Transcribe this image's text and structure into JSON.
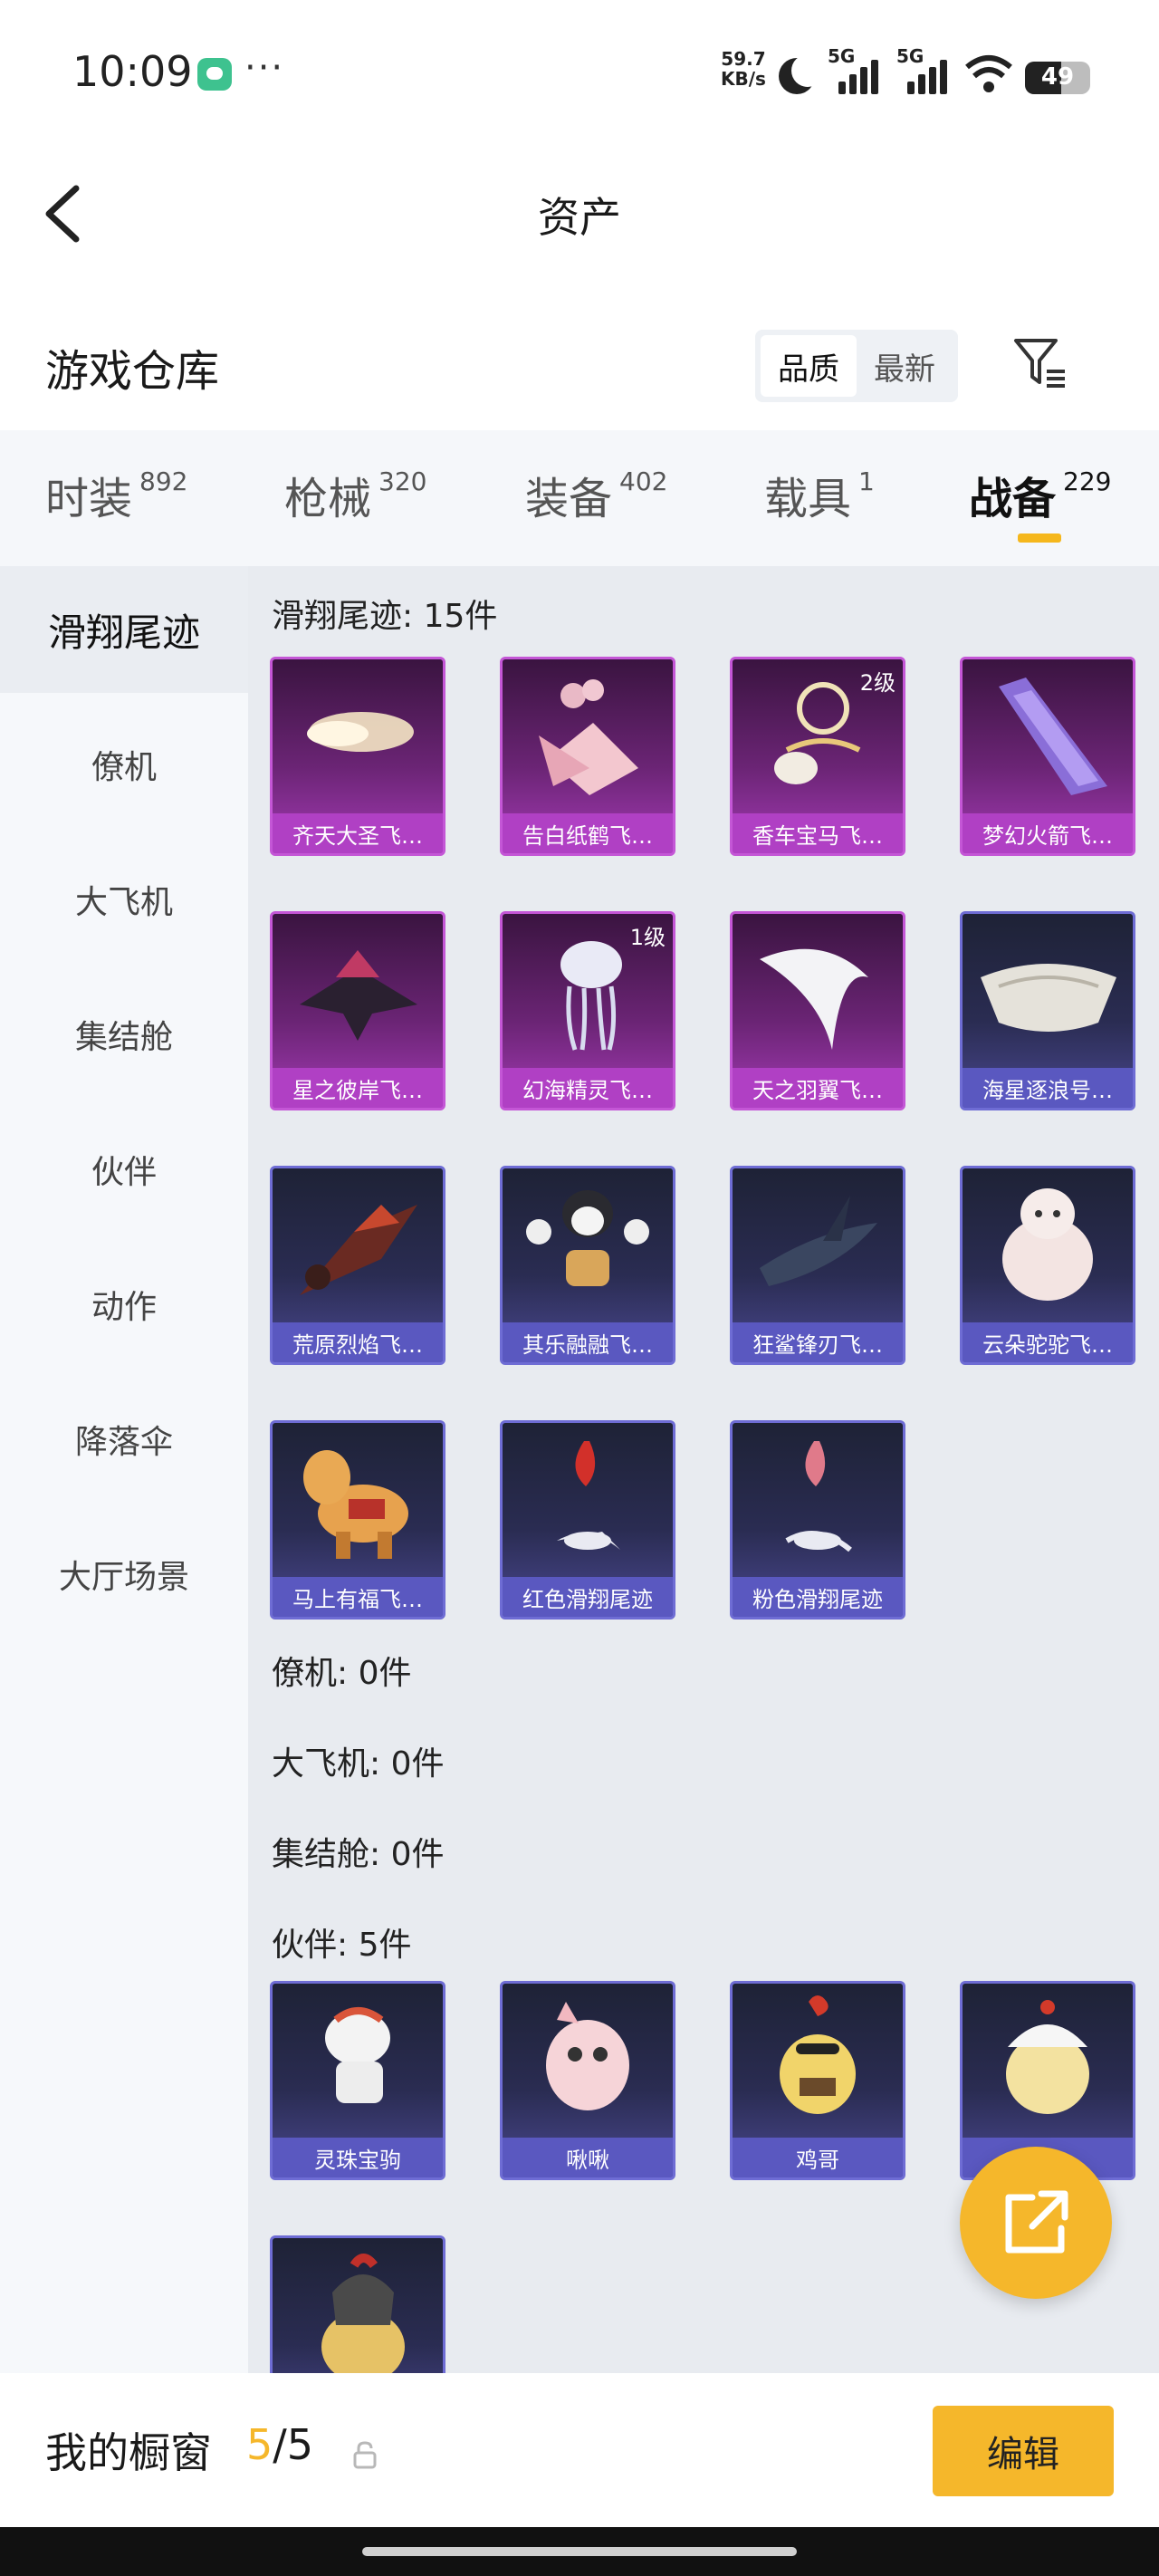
{
  "status_bar": {
    "time": "10:09",
    "net_speed": "59.7",
    "net_unit": "KB/s",
    "sig1": "5G",
    "sig2": "5G",
    "battery": "49"
  },
  "nav": {
    "title": "资产"
  },
  "section": {
    "title": "游戏仓库",
    "sort_quality": "品质",
    "sort_latest": "最新"
  },
  "tabs": [
    {
      "label": "时装",
      "count": "892"
    },
    {
      "label": "枪械",
      "count": "320"
    },
    {
      "label": "装备",
      "count": "402"
    },
    {
      "label": "载具",
      "count": "1"
    },
    {
      "label": "战备",
      "count": "229"
    }
  ],
  "sidebar": [
    {
      "label": "滑翔尾迹"
    },
    {
      "label": "僚机"
    },
    {
      "label": "大飞机"
    },
    {
      "label": "集结舱"
    },
    {
      "label": "伙伴"
    },
    {
      "label": "动作"
    },
    {
      "label": "降落伞"
    },
    {
      "label": "大厅场景"
    }
  ],
  "groups": {
    "trails": "滑翔尾迹: 15件",
    "wingman": "僚机: 0件",
    "plane": "大飞机: 0件",
    "capsule": "集结舱: 0件",
    "partner": "伙伴: 5件"
  },
  "trail_items": [
    {
      "name": "齐天大圣飞…",
      "rarity": "purple",
      "level": ""
    },
    {
      "name": "告白纸鹤飞…",
      "rarity": "purple",
      "level": ""
    },
    {
      "name": "香车宝马飞…",
      "rarity": "purple",
      "level": "2级"
    },
    {
      "name": "梦幻火箭飞…",
      "rarity": "purple",
      "level": ""
    },
    {
      "name": "星之彼岸飞…",
      "rarity": "purple",
      "level": ""
    },
    {
      "name": "幻海精灵飞…",
      "rarity": "purple",
      "level": "1级"
    },
    {
      "name": "天之羽翼飞…",
      "rarity": "purple",
      "level": ""
    },
    {
      "name": "海星逐浪号…",
      "rarity": "blue",
      "level": ""
    },
    {
      "name": "荒原烈焰飞…",
      "rarity": "blue",
      "level": ""
    },
    {
      "name": "其乐融融飞…",
      "rarity": "blue",
      "level": ""
    },
    {
      "name": "狂鲨锋刃飞…",
      "rarity": "blue",
      "level": ""
    },
    {
      "name": "云朵驼驼飞…",
      "rarity": "blue",
      "level": ""
    },
    {
      "name": "马上有福飞…",
      "rarity": "blue",
      "level": ""
    },
    {
      "name": "红色滑翔尾迹",
      "rarity": "blue",
      "level": ""
    },
    {
      "name": "粉色滑翔尾迹",
      "rarity": "blue",
      "level": ""
    }
  ],
  "partner_items": [
    {
      "name": "灵珠宝驹",
      "rarity": "blue"
    },
    {
      "name": "啾啾",
      "rarity": "blue"
    },
    {
      "name": "鸡哥",
      "rarity": "blue"
    },
    {
      "name": "",
      "rarity": "blue"
    },
    {
      "name": "",
      "rarity": "blue"
    }
  ],
  "bottom": {
    "title": "我的橱窗",
    "current": "5",
    "sep_total": "/5",
    "edit_label": "编辑"
  },
  "colors": {
    "accent": "#f5b72b",
    "purple_card": "#b040c4",
    "blue_card": "#5a58c0"
  }
}
